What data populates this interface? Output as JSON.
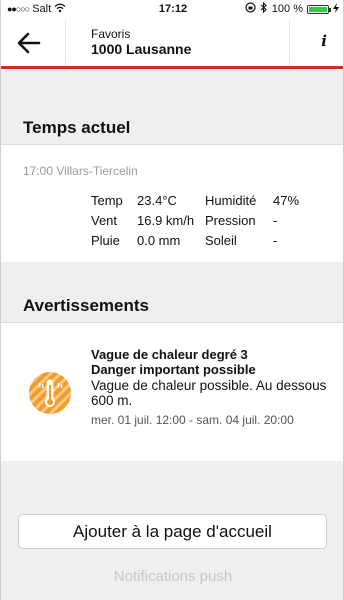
{
  "status_bar": {
    "carrier": "Salt",
    "time": "17:12",
    "battery_text": "100 %"
  },
  "navbar": {
    "subtitle": "Favoris",
    "title": "1000 Lausanne",
    "info_label": "i"
  },
  "current_weather": {
    "section_title": "Temps actuel",
    "station": "17:00 Villars-Tiercelin",
    "rows": [
      {
        "label1": "Temp",
        "value1": "23.4°C",
        "label2": "Humidité",
        "value2": "47%"
      },
      {
        "label1": "Vent",
        "value1": "16.9 km/h",
        "label2": "Pression",
        "value2": "-"
      },
      {
        "label1": "Pluie",
        "value1": "0.0 mm",
        "label2": "Soleil",
        "value2": "-"
      }
    ]
  },
  "warnings": {
    "section_title": "Avertissements",
    "items": [
      {
        "title_line1": "Vague de chaleur degré 3",
        "title_line2": "Danger important possible",
        "description": "Vague de chaleur possible. Au dessous 600 m.",
        "date_range": "mer. 01 juil. 12:00 - sam. 04 juil. 20:00"
      }
    ]
  },
  "actions": {
    "add_home_label": "Ajouter à la page d'accueil",
    "push_label": "Notifications push"
  },
  "colors": {
    "accent_red": "#d52b1e",
    "warning_orange": "#f5a623",
    "section_gray": "#efefef"
  }
}
